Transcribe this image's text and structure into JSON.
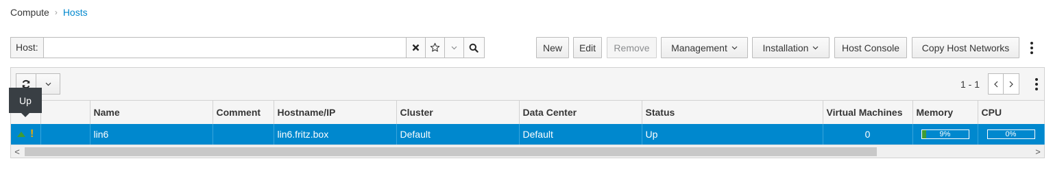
{
  "breadcrumb": {
    "parent": "Compute",
    "separator": "›",
    "current": "Hosts"
  },
  "search": {
    "label": "Host:",
    "value": "",
    "placeholder": ""
  },
  "toolbar": {
    "new_label": "New",
    "edit_label": "Edit",
    "remove_label": "Remove",
    "management_label": "Management",
    "installation_label": "Installation",
    "host_console_label": "Host Console",
    "copy_host_networks_label": "Copy Host Networks"
  },
  "pager": {
    "range": "1 - 1"
  },
  "tooltip": {
    "text": "Up"
  },
  "table": {
    "columns": [
      "",
      "",
      "Name",
      "Comment",
      "Hostname/IP",
      "Cluster",
      "Data Center",
      "Status",
      "Virtual Machines",
      "Memory",
      "CPU"
    ],
    "rows": [
      {
        "name": "lin6",
        "comment": "",
        "hostname": "lin6.fritz.box",
        "cluster": "Default",
        "data_center": "Default",
        "status": "Up",
        "virtual_machines": "0",
        "memory": "9%",
        "memory_fraction": 0.09,
        "cpu": "0%",
        "cpu_fraction": 0.0,
        "warning_glyph": "!"
      }
    ]
  },
  "colors": {
    "accent": "#0088ce",
    "status_up": "#3f9c35",
    "warning": "#f0ab00"
  },
  "icons": [
    "search-icon",
    "clear-icon",
    "star-icon",
    "chevron-down-icon",
    "refresh-icon",
    "kebab-icon",
    "status-up-icon",
    "warning-icon"
  ]
}
